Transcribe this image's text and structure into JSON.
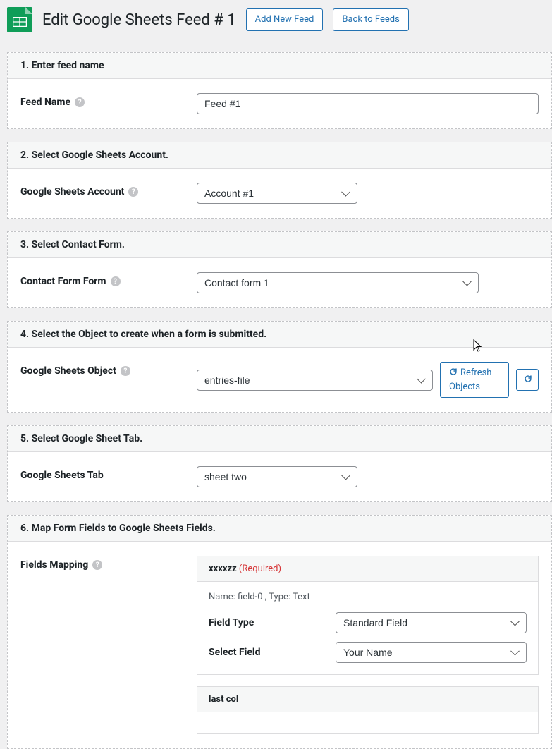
{
  "header": {
    "title": "Edit Google Sheets Feed # 1",
    "add_new": "Add New Feed",
    "back": "Back to Feeds"
  },
  "section1": {
    "title": "1. Enter feed name",
    "label": "Feed Name",
    "value": "Feed #1"
  },
  "section2": {
    "title": "2. Select Google Sheets Account.",
    "label": "Google Sheets Account",
    "value": "Account #1"
  },
  "section3": {
    "title": "3. Select Contact Form.",
    "label": "Contact Form Form",
    "value": "Contact form 1"
  },
  "section4": {
    "title": "4. Select the Object to create when a form is submitted.",
    "label": "Google Sheets Object",
    "value": "entries-file",
    "refresh": "Refresh Objects"
  },
  "section5": {
    "title": "5. Select Google Sheet Tab.",
    "label": "Google Sheets Tab",
    "value": "sheet two"
  },
  "section6": {
    "title": "6. Map Form Fields to Google Sheets Fields.",
    "label": "Fields Mapping",
    "field1": {
      "name": "xxxxzz",
      "required": "(Required)",
      "meta": "Name: field-0 , Type: Text",
      "field_type_label": "Field Type",
      "field_type_value": "Standard Field",
      "select_field_label": "Select Field",
      "select_field_value": "Your Name"
    },
    "field2": {
      "name": "last col"
    }
  }
}
